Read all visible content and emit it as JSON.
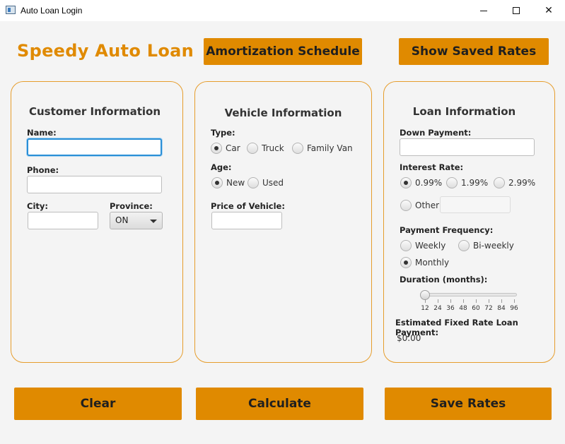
{
  "window": {
    "title": "Auto Loan Login"
  },
  "header": {
    "brand": "Speedy Auto Loan",
    "amortization_label": "Amortization Schedule",
    "saved_rates_label": "Show Saved Rates"
  },
  "customer": {
    "title": "Customer Information",
    "name_label": "Name:",
    "name_value": "",
    "phone_label": "Phone:",
    "phone_value": "",
    "city_label": "City:",
    "city_value": "",
    "province_label": "Province:",
    "province_selected": "ON"
  },
  "vehicle": {
    "title": "Vehicle Information",
    "type_label": "Type:",
    "types": [
      {
        "label": "Car",
        "selected": true
      },
      {
        "label": "Truck",
        "selected": false
      },
      {
        "label": "Family Van",
        "selected": false
      }
    ],
    "age_label": "Age:",
    "ages": [
      {
        "label": "New",
        "selected": true
      },
      {
        "label": "Used",
        "selected": false
      }
    ],
    "price_label": "Price of Vehicle:",
    "price_value": ""
  },
  "loan": {
    "title": "Loan Information",
    "down_payment_label": "Down Payment:",
    "down_payment_value": "",
    "interest_label": "Interest Rate:",
    "rates": [
      {
        "label": "0.99%",
        "selected": true
      },
      {
        "label": "1.99%",
        "selected": false
      },
      {
        "label": "2.99%",
        "selected": false
      },
      {
        "label": "Other:",
        "selected": false
      }
    ],
    "other_rate_value": "",
    "frequency_label": "Payment Frequency:",
    "frequencies": [
      {
        "label": "Weekly",
        "selected": false
      },
      {
        "label": "Bi-weekly",
        "selected": false
      },
      {
        "label": "Monthly",
        "selected": true
      }
    ],
    "duration_label": "Duration (months):",
    "duration_ticks": [
      "12",
      "24",
      "36",
      "48",
      "60",
      "72",
      "84",
      "96"
    ],
    "duration_value": 12,
    "estimate_label": "Estimated Fixed Rate Loan Payment:",
    "estimate_value": "$0.00"
  },
  "footer": {
    "clear_label": "Clear",
    "calculate_label": "Calculate",
    "save_label": "Save Rates"
  },
  "colors": {
    "accent": "#e08a00",
    "panel_border": "#e69d2c",
    "focus": "#2a8fd6"
  }
}
